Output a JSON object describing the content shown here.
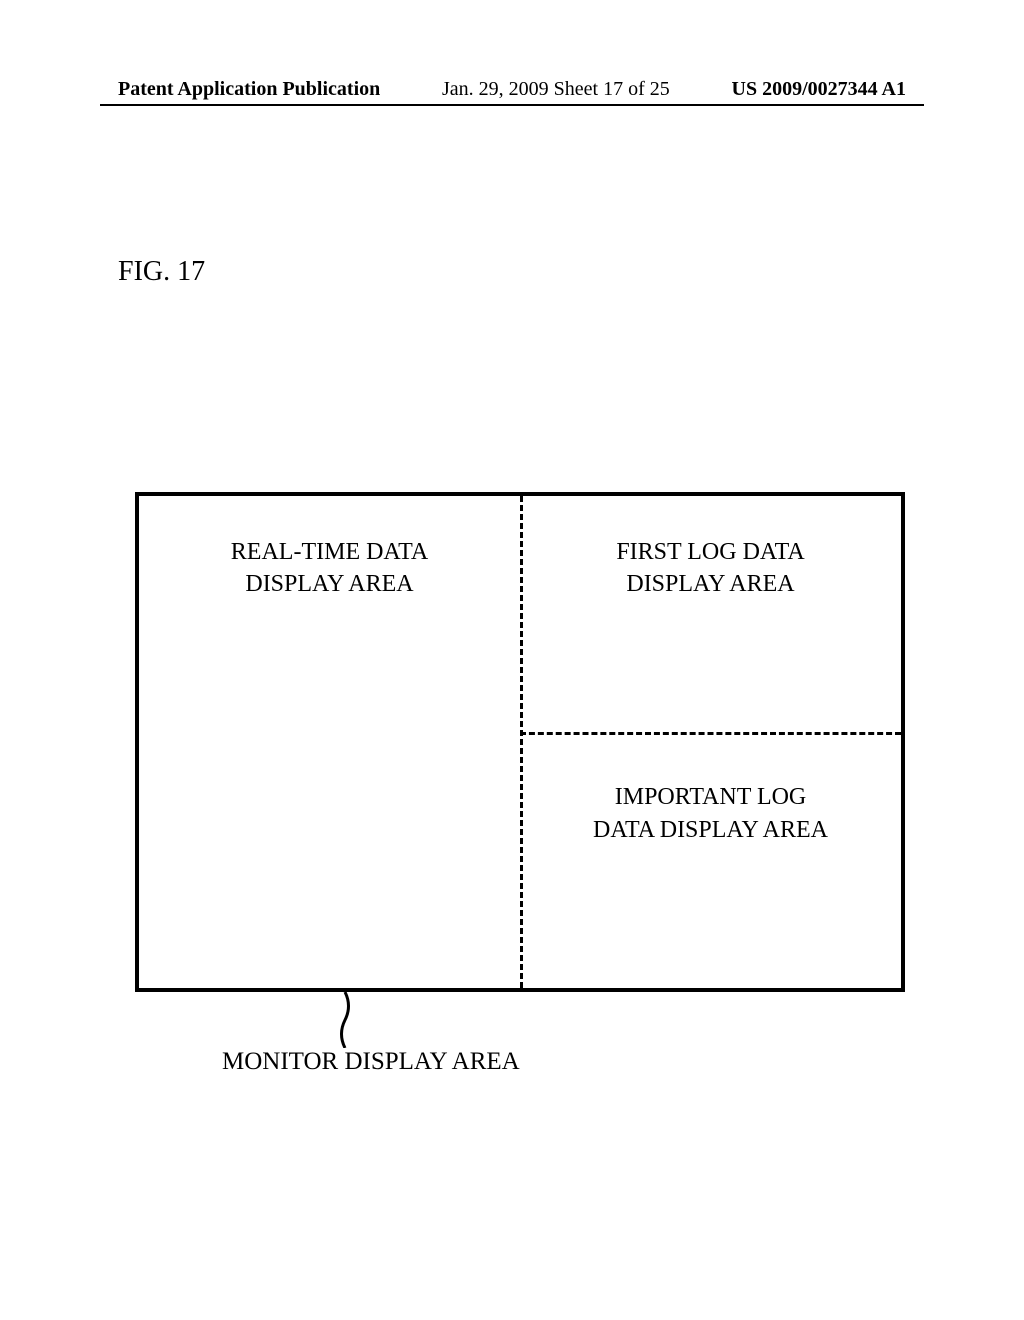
{
  "header": {
    "left": "Patent Application Publication",
    "center": "Jan. 29, 2009  Sheet 17 of 25",
    "right": "US 2009/0027344 A1"
  },
  "figure": {
    "label": "FIG. 17",
    "areas": {
      "realtime_line1": "REAL-TIME DATA",
      "realtime_line2": "DISPLAY AREA",
      "firstlog_line1": "FIRST LOG DATA",
      "firstlog_line2": "DISPLAY AREA",
      "important_line1": "IMPORTANT LOG",
      "important_line2": "DATA DISPLAY AREA"
    },
    "callout_label": "MONITOR DISPLAY AREA"
  }
}
